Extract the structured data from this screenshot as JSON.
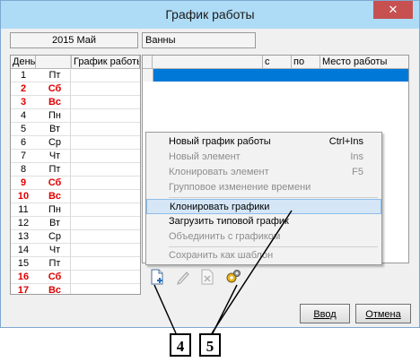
{
  "window": {
    "title": "График работы",
    "close_label": "✕"
  },
  "period": {
    "value": "2015 Май"
  },
  "category": {
    "value": "Ванны"
  },
  "days_table": {
    "headers": [
      "День",
      "",
      "График работы"
    ],
    "rows": [
      {
        "num": "1",
        "day": "Пт",
        "weekend": false
      },
      {
        "num": "2",
        "day": "Сб",
        "weekend": true
      },
      {
        "num": "3",
        "day": "Вс",
        "weekend": true
      },
      {
        "num": "4",
        "day": "Пн",
        "weekend": false
      },
      {
        "num": "5",
        "day": "Вт",
        "weekend": false
      },
      {
        "num": "6",
        "day": "Ср",
        "weekend": false
      },
      {
        "num": "7",
        "day": "Чт",
        "weekend": false
      },
      {
        "num": "8",
        "day": "Пт",
        "weekend": false
      },
      {
        "num": "9",
        "day": "Сб",
        "weekend": true
      },
      {
        "num": "10",
        "day": "Вс",
        "weekend": true
      },
      {
        "num": "11",
        "day": "Пн",
        "weekend": false
      },
      {
        "num": "12",
        "day": "Вт",
        "weekend": false
      },
      {
        "num": "13",
        "day": "Ср",
        "weekend": false
      },
      {
        "num": "14",
        "day": "Чт",
        "weekend": false
      },
      {
        "num": "15",
        "day": "Пт",
        "weekend": false
      },
      {
        "num": "16",
        "day": "Сб",
        "weekend": true
      },
      {
        "num": "17",
        "day": "Вс",
        "weekend": true
      }
    ]
  },
  "schedule_table": {
    "headers": [
      "",
      "",
      "с",
      "по",
      "Место работы"
    ]
  },
  "context_menu": {
    "items": [
      {
        "label": "Новый график работы",
        "shortcut": "Ctrl+Ins",
        "disabled": false,
        "highlighted": false
      },
      {
        "label": "Новый элемент",
        "shortcut": "Ins",
        "disabled": true,
        "highlighted": false
      },
      {
        "label": "Клонировать элемент",
        "shortcut": "F5",
        "disabled": true,
        "highlighted": false
      },
      {
        "label": "Групповое изменение времени",
        "shortcut": "",
        "disabled": true,
        "highlighted": false
      },
      {
        "label": "Клонировать графики",
        "shortcut": "",
        "disabled": false,
        "highlighted": true
      },
      {
        "label": "Загрузить типовой график",
        "shortcut": "",
        "disabled": false,
        "highlighted": false
      },
      {
        "label": "Объединить с графиком",
        "shortcut": "",
        "disabled": true,
        "highlighted": false
      },
      {
        "label": "Сохранить как шаблон",
        "shortcut": "",
        "disabled": true,
        "highlighted": false
      }
    ]
  },
  "toolbar": {
    "icons": [
      "new-document-icon",
      "edit-icon",
      "delete-icon",
      "gears-icon"
    ]
  },
  "buttons": {
    "ok": "Ввод",
    "cancel": "Отмена"
  },
  "callouts": {
    "a": "4",
    "b": "5"
  },
  "colors": {
    "weekend": "#e00000",
    "selection": "#0078d7",
    "title_bar": "#aedcf6",
    "close": "#c75050"
  }
}
